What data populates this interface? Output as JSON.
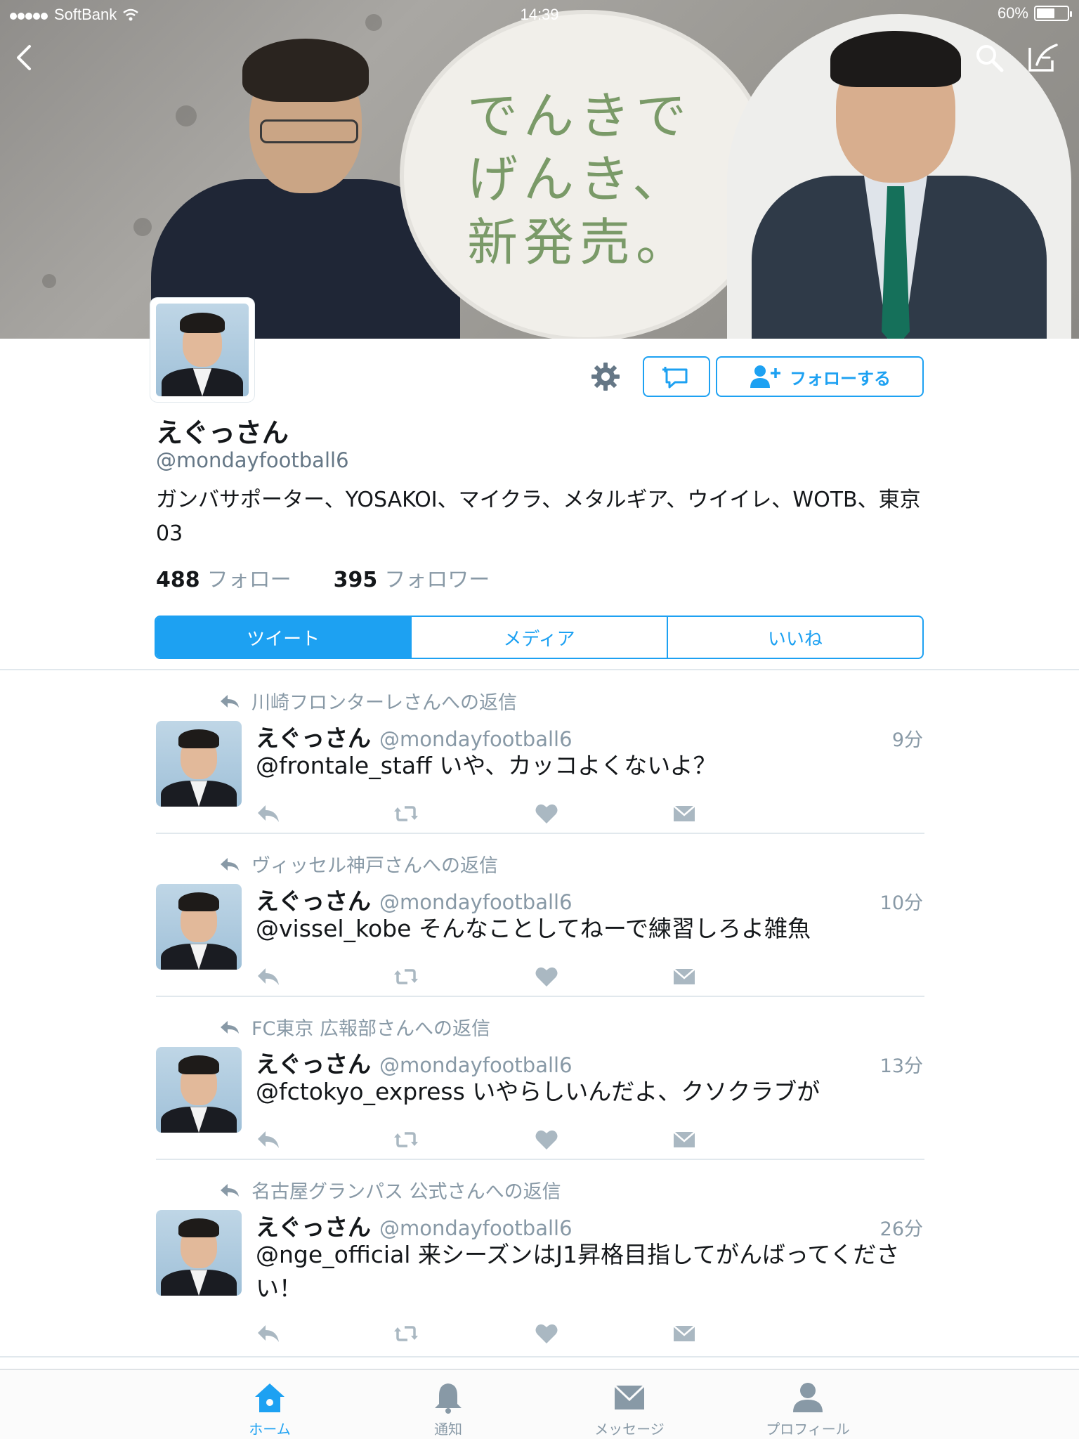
{
  "status_bar": {
    "carrier": "SoftBank",
    "time": "14:39",
    "battery": "60%",
    "battery_level": 0.6
  },
  "banner": {
    "bubble_text": "でんきで げんき、 新発売。"
  },
  "profile": {
    "display_name": "えぐっさん",
    "handle": "@mondayfootball6",
    "bio": "ガンバサポーター、YOSAKOI、マイクラ、メタルギア、ウイイレ、WOTB、東京03",
    "following_count": "488",
    "following_label": "フォロー",
    "followers_count": "395",
    "followers_label": "フォロワー",
    "follow_button": "フォローする"
  },
  "tabs": [
    {
      "label": "ツイート",
      "active": true
    },
    {
      "label": "メディア",
      "active": false
    },
    {
      "label": "いいね",
      "active": false
    }
  ],
  "tweets": [
    {
      "reply_to": "川崎フロンターレさんへの返信",
      "name": "えぐっさん",
      "handle": "@mondayfootball6",
      "time": "9分",
      "text": "@frontale_staff いや、カッコよくないよ？"
    },
    {
      "reply_to": "ヴィッセル神戸さんへの返信",
      "name": "えぐっさん",
      "handle": "@mondayfootball6",
      "time": "10分",
      "text": "@vissel_kobe そんなことしてねーで練習しろよ雑魚"
    },
    {
      "reply_to": "FC東京 広報部さんへの返信",
      "name": "えぐっさん",
      "handle": "@mondayfootball6",
      "time": "13分",
      "text": "@fctokyo_express いやらしいんだよ、クソクラブが"
    },
    {
      "reply_to": "名古屋グランパス 公式さんへの返信",
      "name": "えぐっさん",
      "handle": "@mondayfootball6",
      "time": "26分",
      "text": "@nge_official 来シーズンはJ1昇格目指してがんばってください！"
    }
  ],
  "tab_bar": [
    {
      "label": "ホーム",
      "icon": "home-icon",
      "active": true
    },
    {
      "label": "通知",
      "icon": "bell-icon",
      "active": false
    },
    {
      "label": "メッセージ",
      "icon": "envelope-icon",
      "active": false
    },
    {
      "label": "プロフィール",
      "icon": "person-icon",
      "active": false
    }
  ],
  "colors": {
    "accent": "#1da1f2",
    "muted": "#8899a6",
    "text": "#14171a"
  }
}
